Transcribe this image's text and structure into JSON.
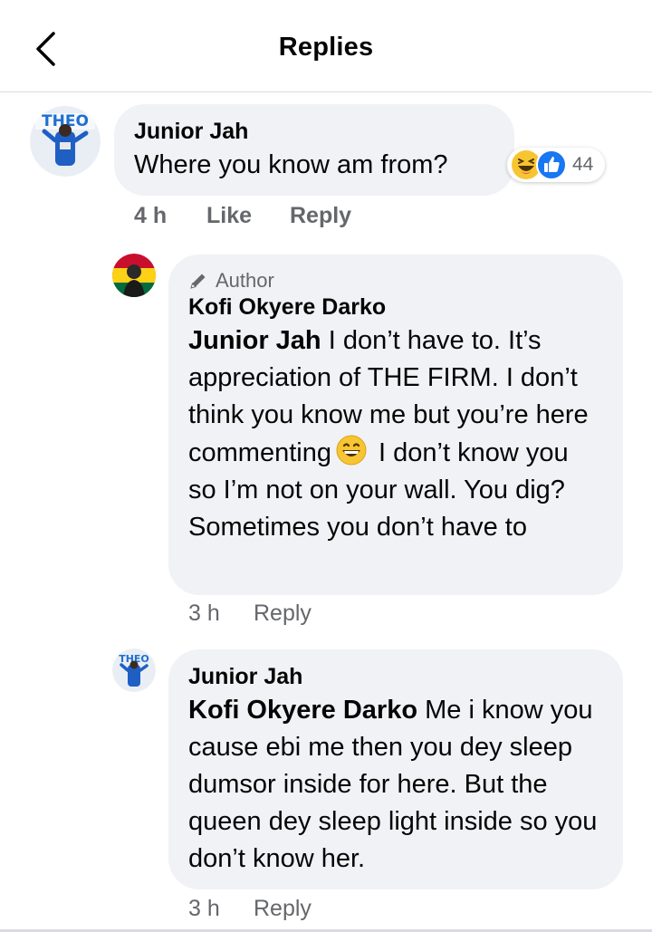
{
  "header": {
    "title": "Replies"
  },
  "comments": [
    {
      "author": "Junior Jah",
      "text": "Where you know am from?",
      "time": "4 h",
      "like_label": "Like",
      "reply_label": "Reply",
      "reactions": {
        "icons": [
          "haha-icon",
          "like-icon"
        ],
        "count": "44"
      },
      "avatar_text": "THEO"
    },
    {
      "badge": "Author",
      "author": "Kofi Okyere Darko",
      "mention": "Junior Jah",
      "text_before_emoji": " I don’t have to. It’s appreciation of THE FIRM. I don’t think you know me but you’re here commenting",
      "text_after_emoji": " I don’t know you so I’m not on your wall. You dig? Sometimes you don’t have to",
      "time": "3 h",
      "reply_label": "Reply"
    },
    {
      "author": "Junior Jah",
      "mention": "Kofi Okyere Darko",
      "text": " Me i know you cause ebi me then you dey sleep dumsor inside for here. But the queen dey sleep light inside so you don’t know her.",
      "time": "3 h",
      "reply_label": "Reply",
      "avatar_text": "THEO"
    }
  ],
  "colors": {
    "bubble": "#f0f2f5",
    "meta_text": "#65676b",
    "like_blue": "#1877f2",
    "haha_yellow": "#f7c531"
  }
}
